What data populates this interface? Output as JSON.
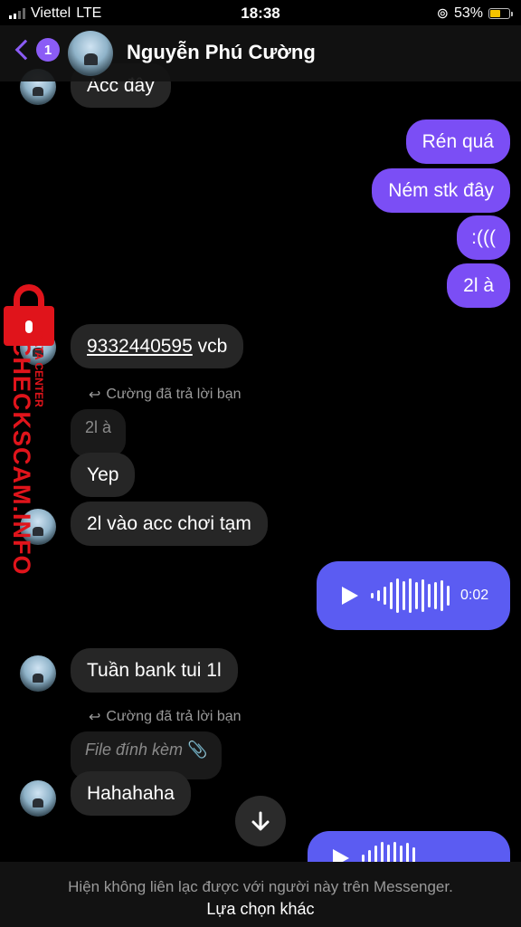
{
  "status_bar": {
    "carrier": "Viettel",
    "network": "LTE",
    "time": "18:38",
    "battery": "53%"
  },
  "header": {
    "back_count": "1",
    "contact_name": "Nguyễn Phú Cường"
  },
  "messages": {
    "m0": "Acc đây",
    "m1": "Rén quá",
    "m2": "Ném stk đây",
    "m3": ":(((",
    "m4": "2l à",
    "m5_number": "9332440595",
    "m5_suffix": " vcb",
    "reply_note_1": "Cường đã trả lời bạn",
    "quoted_1": "2l à",
    "m6": "Yep",
    "m7": "2l vào acc chơi tạm",
    "voice_1_duration": "0:02",
    "m8": "Tuần bank tui 1l",
    "reply_note_2": "Cường đã trả lời bạn",
    "quoted_2": "File đính kèm",
    "m9": "Hahahaha"
  },
  "footer": {
    "info": "Hiện không liên lạc được với người này trên Messenger.",
    "link": "Lựa chọn khác"
  },
  "watermark": {
    "text": "CHECKSCAM.INFO",
    "subtext": "DATA CENTER"
  },
  "colors": {
    "outgoing": "#7b4ef5",
    "voice": "#5b5cf2",
    "incoming": "#262626",
    "accent": "#8b5cf6"
  }
}
